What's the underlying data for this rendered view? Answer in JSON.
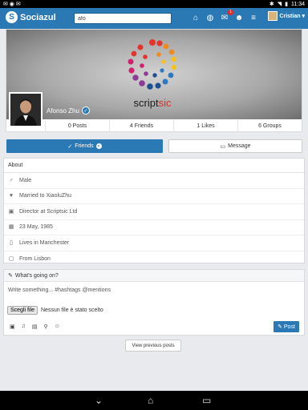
{
  "status_bar": {
    "time": "11:34"
  },
  "header": {
    "app_name": "Sociazul",
    "search_value": "afo",
    "notification_count": "1",
    "user_name": "Cristian"
  },
  "profile": {
    "name": "Afonso Zhu",
    "cover_brand": {
      "part1": "script",
      "part2": "sic"
    },
    "stats": [
      "0 Posts",
      "4 Friends",
      "1 Likes",
      "6 Groups"
    ]
  },
  "actions": {
    "friends_label": "Friends",
    "message_label": "Message"
  },
  "about": {
    "title": "About",
    "items": [
      {
        "icon": "gender-icon",
        "text": "Male"
      },
      {
        "icon": "heart-icon",
        "text": "Married to XiaoluZhu"
      },
      {
        "icon": "briefcase-icon",
        "text": "Director at Scriptsic Ltd"
      },
      {
        "icon": "calendar-icon",
        "text": "23 May, 1985"
      },
      {
        "icon": "home-icon",
        "text": "Lives in Manchester"
      },
      {
        "icon": "location-icon",
        "text": "From Lisbon"
      }
    ]
  },
  "composer": {
    "title": "What's going on?",
    "placeholder": "Write something... #hashtags @mentions",
    "file_button": "Scegli file",
    "file_status": "Nessun file è stato scelto",
    "post_label": "Post"
  },
  "feed": {
    "prev_label": "View previous posts"
  },
  "colors": {
    "brand": "#2b79b4",
    "badge": "#d9302b"
  }
}
